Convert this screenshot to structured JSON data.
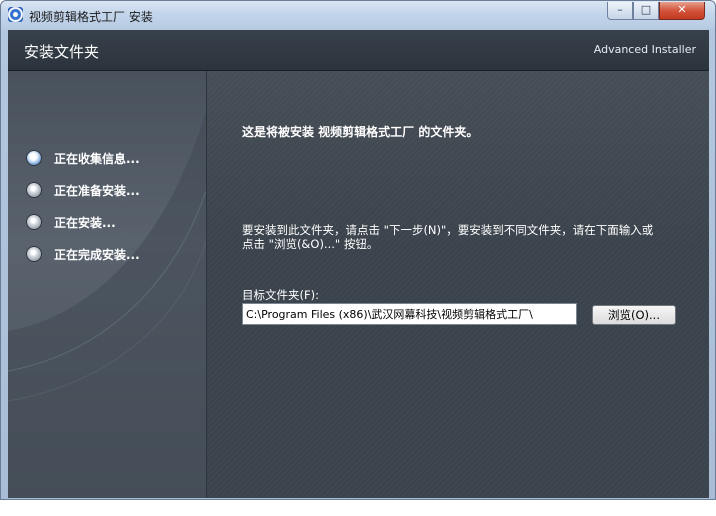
{
  "window": {
    "title": "视频剪辑格式工厂 安装",
    "minimize_glyph": "–",
    "maximize_glyph": "□",
    "close_glyph": "✕"
  },
  "header": {
    "title": "安装文件夹",
    "brand": "Advanced Installer"
  },
  "steps": [
    {
      "label": "正在收集信息...",
      "active": true
    },
    {
      "label": "正在准备安装...",
      "active": false
    },
    {
      "label": "正在安装...",
      "active": false
    },
    {
      "label": "正在完成安装...",
      "active": false
    }
  ],
  "main": {
    "heading": "这是将被安装 视频剪辑格式工厂 的文件夹。",
    "description_line1": "要安装到此文件夹，请点击 \"下一步(N)\"，要安装到不同文件夹，请在下面输入或",
    "description_line2": "点击 \"浏览(&O)...\" 按钮。",
    "folder_label": "目标文件夹(F):",
    "folder_value": "C:\\Program Files (x86)\\武汉网幕科技\\视频剪辑格式工厂\\",
    "browse_label": "浏览(O)..."
  },
  "colors": {
    "header_bg": "#2f373f",
    "sidebar_bg": "#535c66",
    "main_bg": "#3c444d",
    "accent_radio": "#6d9ad0"
  },
  "icons": {
    "app": "installer-app-icon",
    "step_marker": "radio-bullet-icon"
  }
}
